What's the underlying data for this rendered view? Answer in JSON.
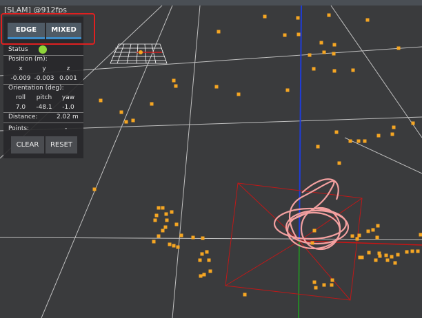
{
  "window": {
    "title": "[SLAM]  @912fps"
  },
  "modes": {
    "edge_label": "EDGE",
    "mixed_label": "MIXED"
  },
  "panel": {
    "status_label": "Status",
    "position_label": "Position (m):",
    "position_headers": [
      "x",
      "y",
      "z"
    ],
    "position_values": [
      "-0.009",
      "-0.003",
      "0.001"
    ],
    "orientation_label": "Orientation (deg):",
    "orientation_headers": [
      "roll",
      "pitch",
      "yaw"
    ],
    "orientation_values": [
      "7.0",
      "-48.1",
      "-1.0"
    ],
    "distance_label": "Distance:",
    "distance_value": "2.02",
    "distance_unit": "m",
    "points_label": "Points:",
    "points_value": "-",
    "clear_label": "CLEAR",
    "reset_label": "RESET"
  },
  "colors": {
    "point": "#f5a623",
    "trajectory": "#f3a0a0",
    "bbox": "#c01818",
    "status_ok": "#8fd63a",
    "highlight": "#e02020"
  }
}
